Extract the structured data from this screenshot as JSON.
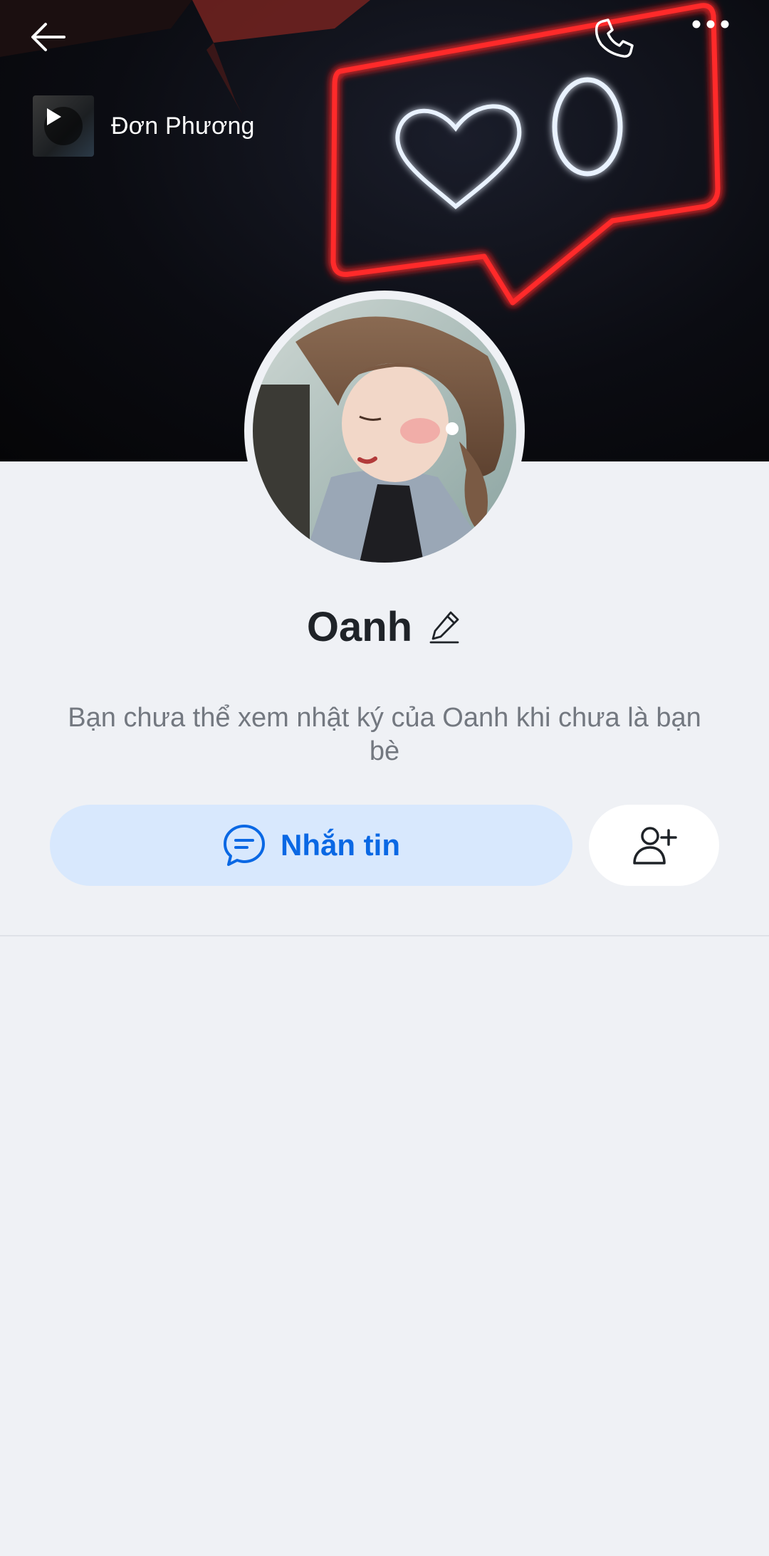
{
  "header": {
    "back_icon": "arrow-left-icon",
    "call_icon": "phone-icon",
    "more_icon": "more-horizontal-icon"
  },
  "music": {
    "title": "Đơn Phương",
    "play_icon": "play-icon"
  },
  "profile": {
    "name": "Oanh",
    "edit_icon": "pencil-icon",
    "notice": "Bạn chưa thể xem nhật ký của Oanh khi chưa là bạn bè"
  },
  "actions": {
    "message_label": "Nhắn tin",
    "message_icon": "chat-bubble-icon",
    "add_friend_icon": "add-user-icon"
  },
  "colors": {
    "accent": "#0a68e4",
    "message_button_bg": "#d8e8fd",
    "page_bg": "#eff1f5",
    "neon_red": "#ff2a2a",
    "neon_white": "#e9f2ff"
  }
}
